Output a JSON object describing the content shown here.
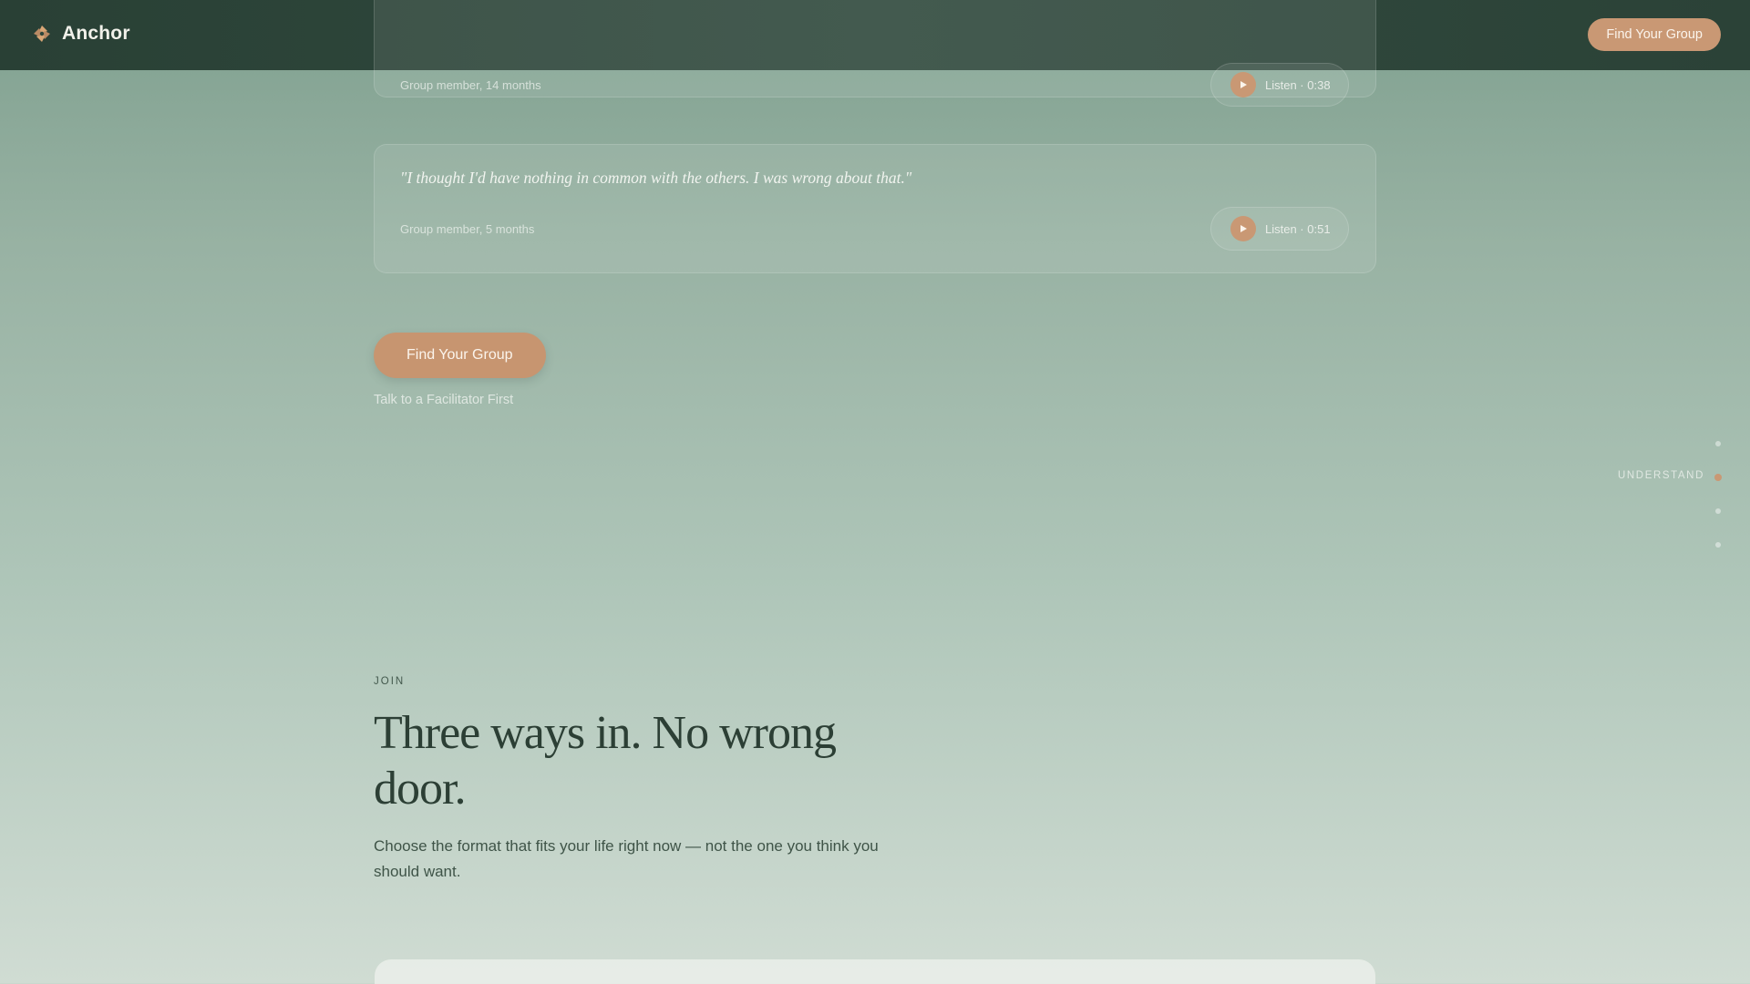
{
  "header": {
    "brand": "Anchor",
    "cta_label": "Find Your Group"
  },
  "testimonials": [
    {
      "attribution": "Group member, 14 months",
      "listen_label": "Listen · 0:38"
    },
    {
      "quote": "\"I thought I'd have nothing in common with the others. I was wrong about that.\"",
      "attribution": "Group member, 5 months",
      "listen_label": "Listen · 0:51"
    }
  ],
  "cta": {
    "primary_label": "Find Your Group",
    "secondary_label": "Talk to a Facilitator First"
  },
  "side_nav": {
    "active_label": "UNDERSTAND",
    "active_index": 1,
    "dot_count": 4
  },
  "join": {
    "eyebrow": "JOIN",
    "heading": "Three ways in. No wrong door.",
    "subtext": "Choose the format that fits your life right now — not the one you think you should want."
  },
  "colors": {
    "header_bg": "#2e463b",
    "accent": "#c99874",
    "heading": "#2c3f35"
  },
  "icons": {
    "logo": "anchor-logo-icon",
    "play": "play-icon"
  }
}
